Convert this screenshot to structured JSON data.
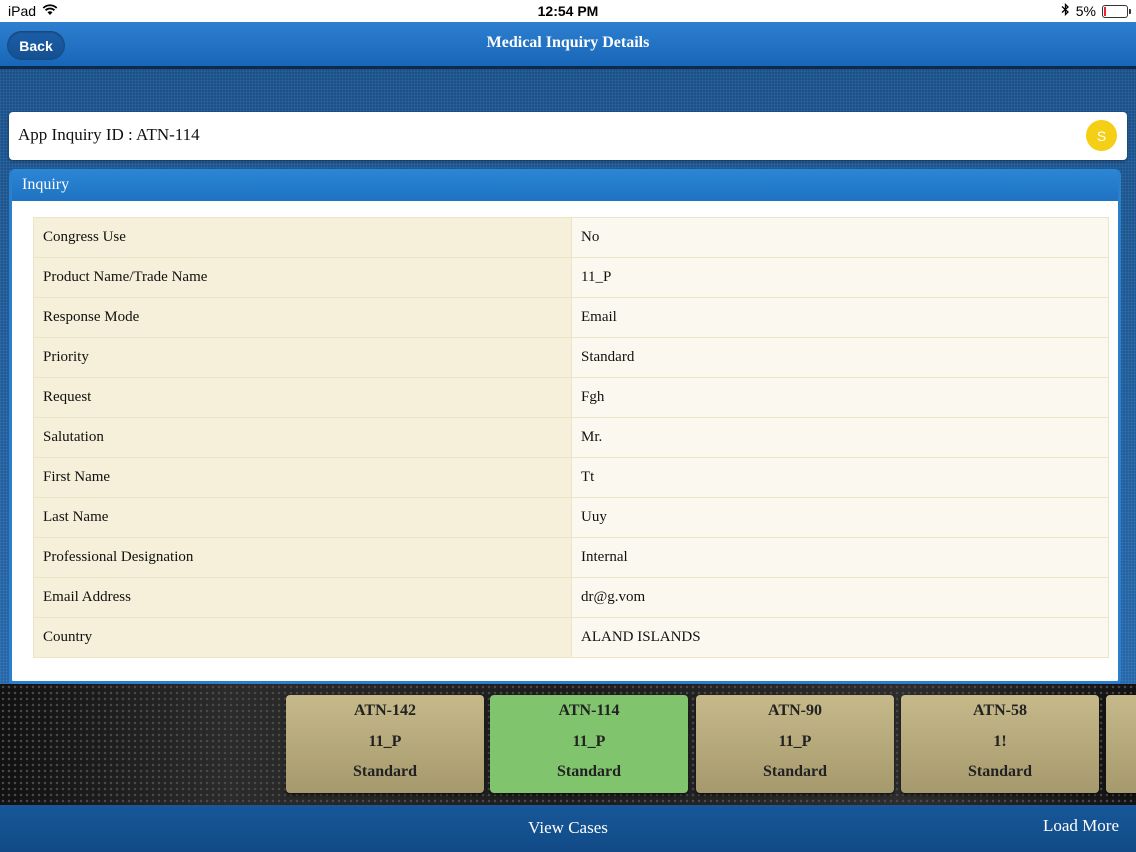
{
  "status_bar": {
    "device": "iPad",
    "time": "12:54 PM",
    "battery_percent": "5%"
  },
  "nav": {
    "back_label": "Back",
    "title": "Medical Inquiry Details"
  },
  "inquiry": {
    "id_label": "App Inquiry ID : ATN-114",
    "status_initial": "S",
    "status_color": "#f4cf16"
  },
  "section": {
    "title": "Inquiry"
  },
  "fields": [
    {
      "label": "Congress Use",
      "value": "No"
    },
    {
      "label": "Product Name/Trade Name",
      "value": "11_P"
    },
    {
      "label": "Response Mode",
      "value": "Email"
    },
    {
      "label": "Priority",
      "value": "Standard"
    },
    {
      "label": "Request",
      "value": "Fgh"
    },
    {
      "label": "Salutation",
      "value": "Mr."
    },
    {
      "label": "First Name",
      "value": "Tt"
    },
    {
      "label": "Last Name",
      "value": "Uuy"
    },
    {
      "label": "Professional Designation",
      "value": "Internal"
    },
    {
      "label": "Email Address",
      "value": "dr@g.vom"
    },
    {
      "label": "Country",
      "value": "ALAND ISLANDS"
    }
  ],
  "cases": [
    {
      "id": "ATN-142",
      "product": "11_P",
      "priority": "Standard",
      "active": false
    },
    {
      "id": "ATN-114",
      "product": "11_P",
      "priority": "Standard",
      "active": true
    },
    {
      "id": "ATN-90",
      "product": "11_P",
      "priority": "Standard",
      "active": false
    },
    {
      "id": "ATN-58",
      "product": "1!",
      "priority": "Standard",
      "active": false
    }
  ],
  "bottom": {
    "view_cases": "View Cases",
    "load_more": "Load More"
  }
}
